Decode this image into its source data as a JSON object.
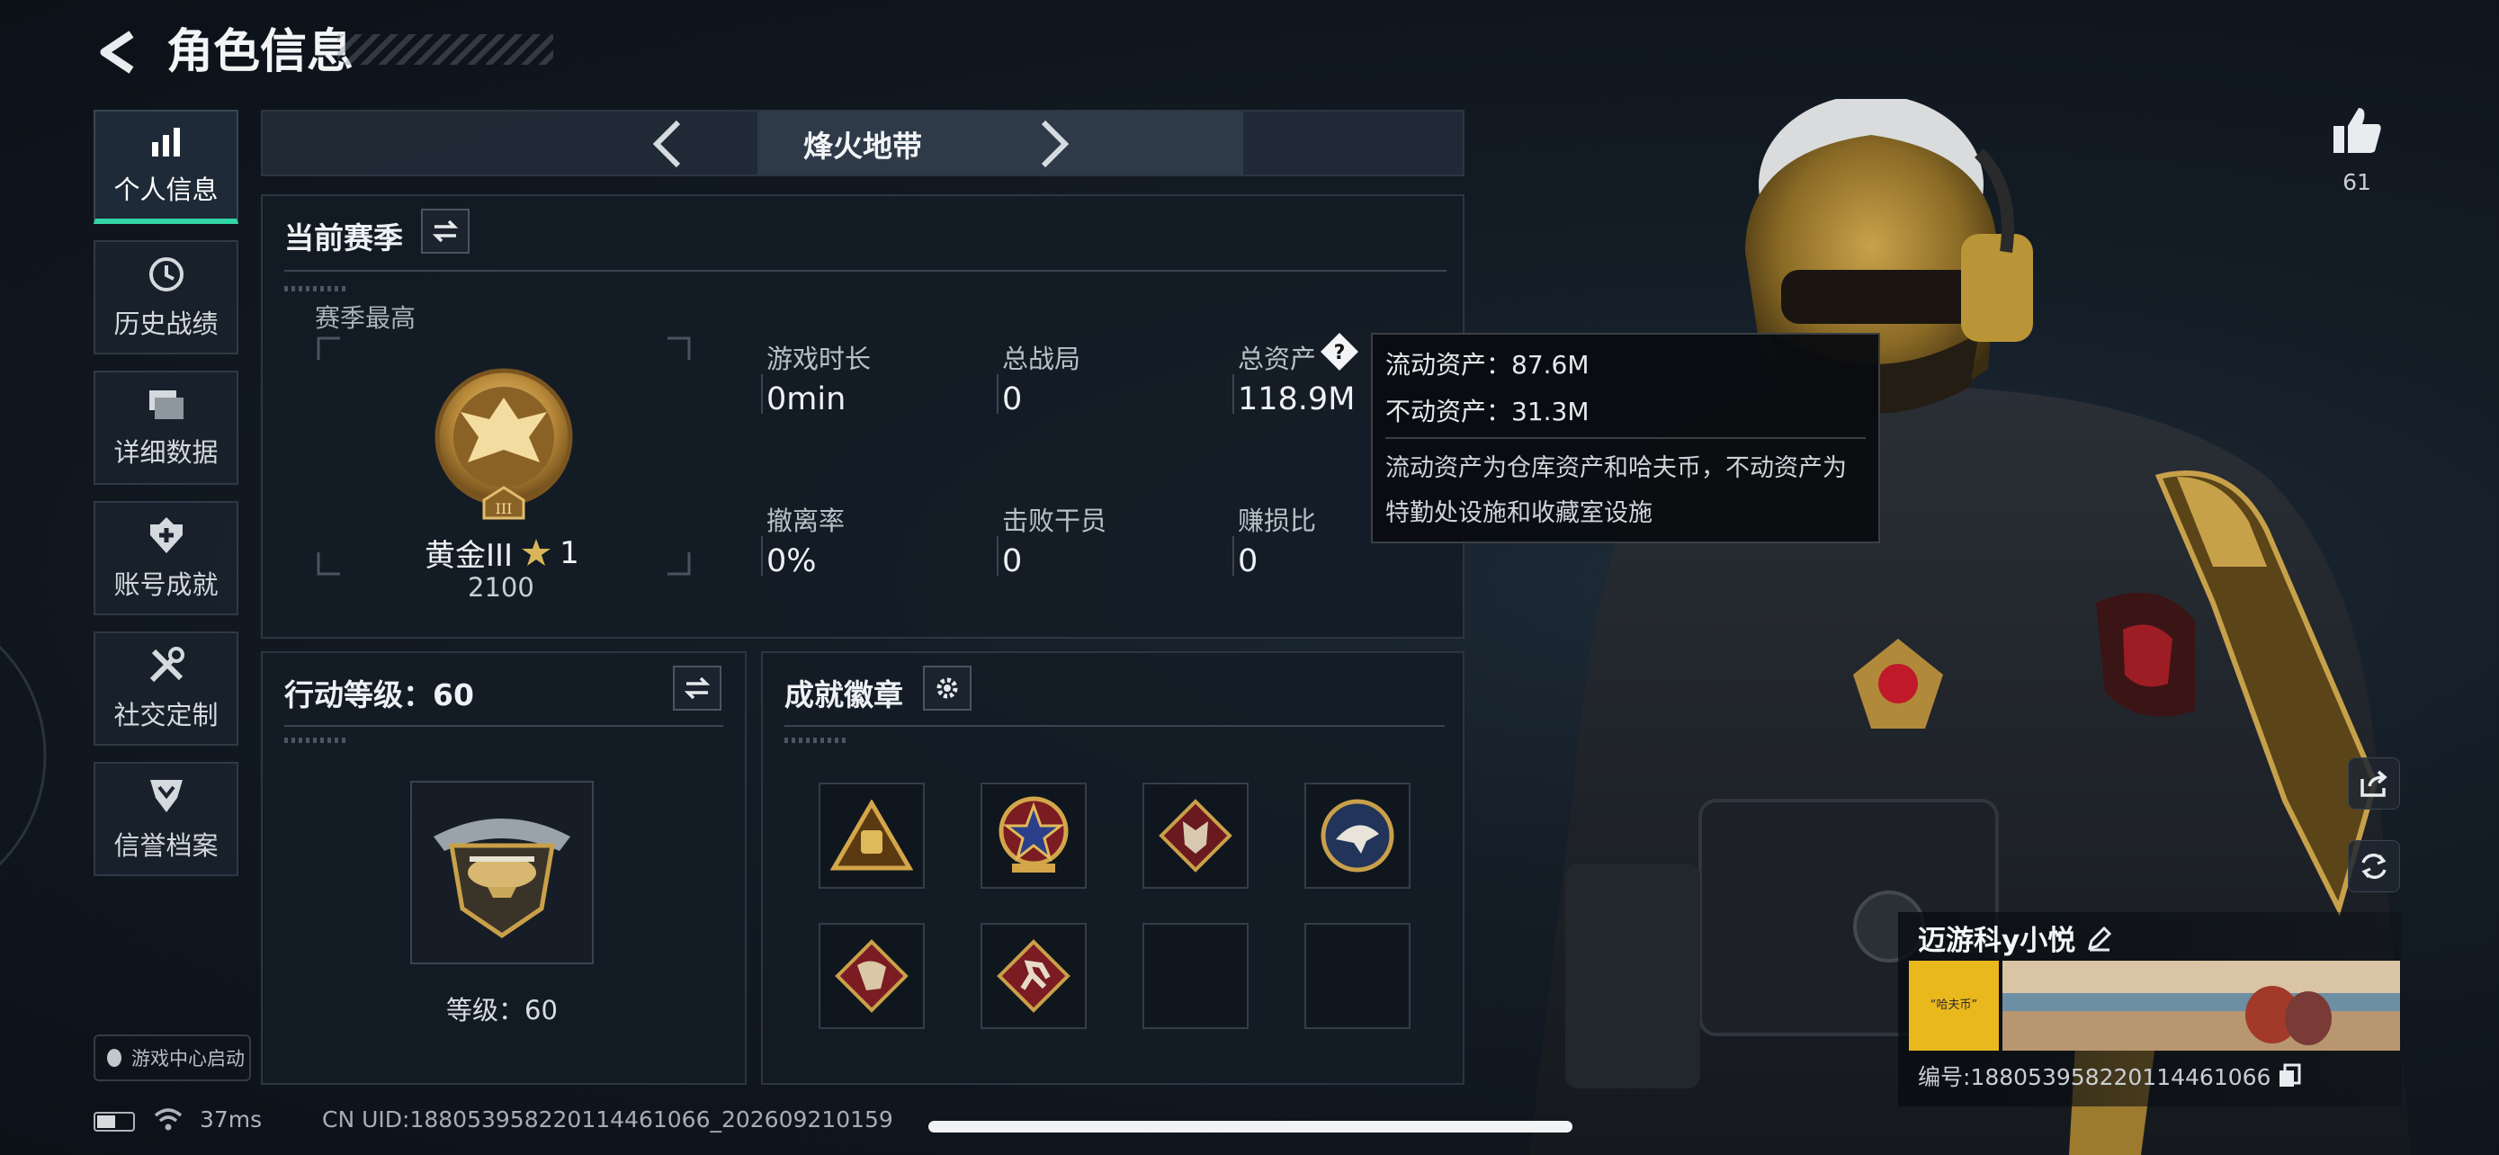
{
  "header": {
    "title": "角色信息"
  },
  "sidebar": {
    "items": [
      {
        "label": "个人信息",
        "icon": "bar-chart-icon",
        "active": true
      },
      {
        "label": "历史战绩",
        "icon": "history-clock-icon",
        "active": false
      },
      {
        "label": "详细数据",
        "icon": "folders-icon",
        "active": false
      },
      {
        "label": "账号成就",
        "icon": "medal-plus-icon",
        "active": false
      },
      {
        "label": "社交定制",
        "icon": "tools-icon",
        "active": false
      },
      {
        "label": "信誉档案",
        "icon": "shield-chevron-icon",
        "active": false
      }
    ],
    "game_center": "游戏中心启动"
  },
  "mode": {
    "name": "烽火地带"
  },
  "season": {
    "title": "当前赛季",
    "best_label": "赛季最高",
    "rank_name": "黄金III",
    "rank_stars": "1",
    "rank_points": "2100",
    "rank_numeral": "III",
    "stats": [
      {
        "label": "游戏时长",
        "value": "0min"
      },
      {
        "label": "总战局",
        "value": "0"
      },
      {
        "label": "总资产",
        "value": "118.9M"
      },
      {
        "label": "撤离率",
        "value": "0%"
      },
      {
        "label": "击败干员",
        "value": "0"
      },
      {
        "label": "赚损比",
        "value": "0"
      }
    ]
  },
  "tooltip": {
    "liquid": "流动资产：87.6M",
    "fixed": "不动资产：31.3M",
    "desc": "流动资产为仓库资产和哈夫币，不动资产为特勤处设施和收藏室设施"
  },
  "action_level": {
    "title": "行动等级：60",
    "level_label": "等级：60"
  },
  "badges": {
    "title": "成就徽章",
    "slots": [
      {
        "icon": "triangle-bag-badge-icon",
        "filled": true
      },
      {
        "icon": "star-shield-badge-icon",
        "filled": true
      },
      {
        "icon": "wolf-badge-icon",
        "filled": true
      },
      {
        "icon": "eagle-badge-icon",
        "filled": true
      },
      {
        "icon": "dragon-badge-icon",
        "filled": true
      },
      {
        "icon": "runner-badge-icon",
        "filled": true
      },
      {
        "icon": "",
        "filled": false
      },
      {
        "icon": "",
        "filled": false
      }
    ]
  },
  "profile": {
    "like_count": "61",
    "player_name": "迈游科y小悦",
    "uid_line": "编号:1880539582201144610​66",
    "banner_text": "“哈夫币”"
  },
  "status": {
    "ping": "37ms",
    "cn_uid": "CN UID:18805395822011446106​6_202609210159"
  },
  "colors": {
    "accent": "#33d6a6",
    "gold": "#c9a04a",
    "background": "#131b24"
  }
}
